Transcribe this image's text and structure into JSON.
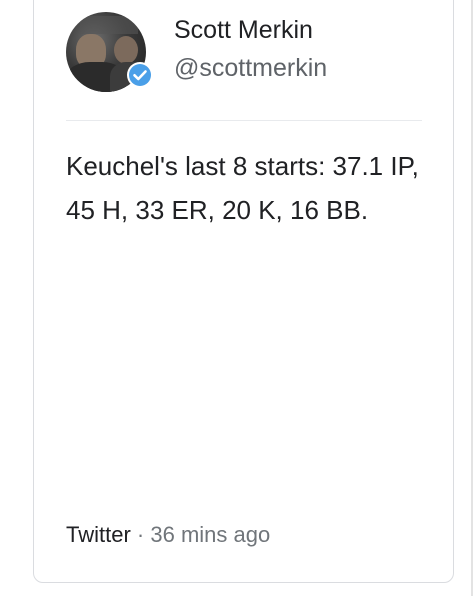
{
  "author": {
    "name": "Scott Merkin",
    "handle": "@scottmerkin",
    "verified": true,
    "verified_badge_color": "#4a9fe8"
  },
  "tweet": {
    "text": "Keuchel's last 8 starts: 37.1 IP, 45 H, 33 ER, 20 K, 16 BB."
  },
  "footer": {
    "source": "Twitter",
    "separator": "·",
    "time": "36 mins ago"
  }
}
